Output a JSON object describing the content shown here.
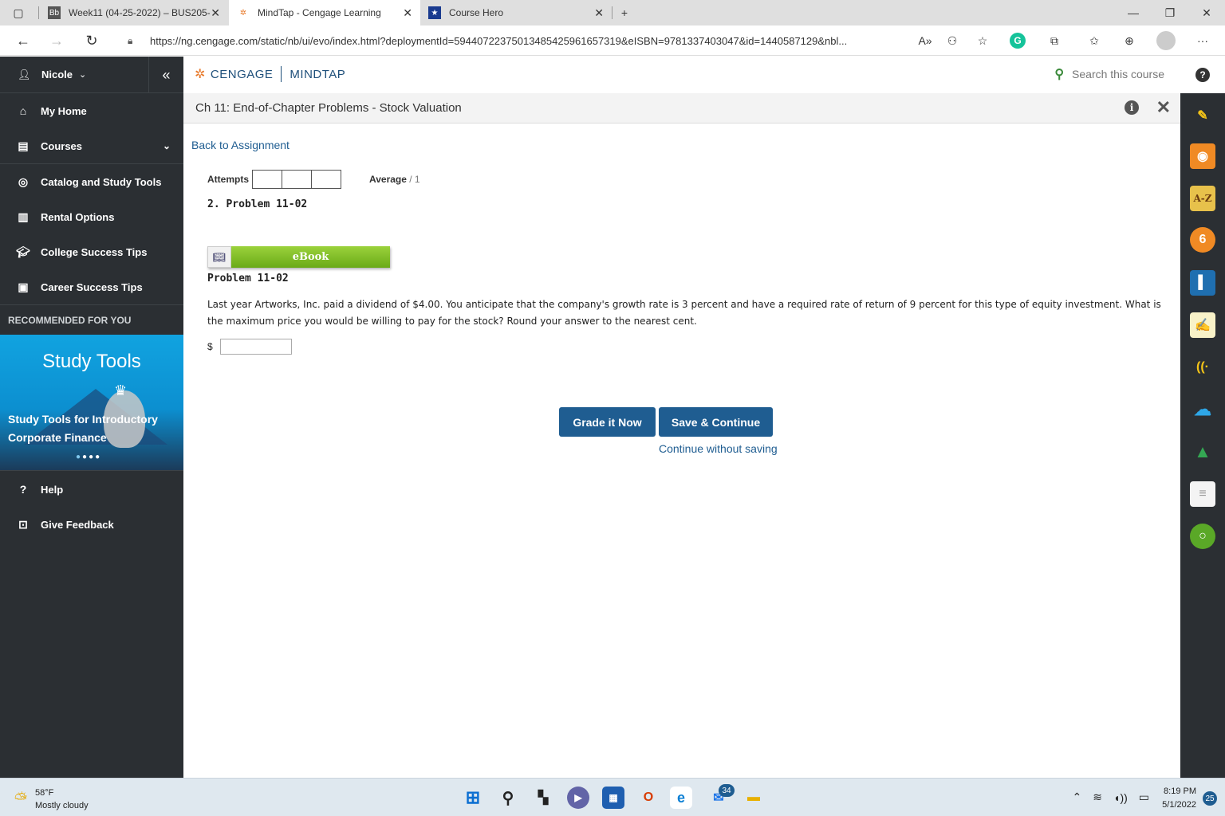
{
  "browser": {
    "tabs": [
      {
        "title": "Week11 (04-25-2022) – BUS205-",
        "favicon": "Bb"
      },
      {
        "title": "MindTap - Cengage Learning",
        "favicon": "cengage-icon"
      },
      {
        "title": "Course Hero",
        "favicon": "coursehero-icon"
      }
    ],
    "url": "https://ng.cengage.com/static/nb/ui/evo/index.html?deploymentId=59440722375013485425961657319&eISBN=9781337403047&id=1440587129&nbl..."
  },
  "sidebar": {
    "user": "Nicole",
    "items": [
      {
        "label": "My Home",
        "icon": "home-icon"
      },
      {
        "label": "Courses",
        "icon": "book-icon"
      },
      {
        "label": "Catalog and Study Tools",
        "icon": "compass-icon"
      },
      {
        "label": "Rental Options",
        "icon": "open-book-icon"
      },
      {
        "label": "College Success Tips",
        "icon": "graduation-cap-icon"
      },
      {
        "label": "Career Success Tips",
        "icon": "briefcase-icon"
      }
    ],
    "recommended_heading": "RECOMMENDED FOR YOU",
    "promo": {
      "title": "Study Tools",
      "text": "Study Tools for Introductory Corporate Finance"
    },
    "bottom": [
      {
        "label": "Help",
        "icon": "help-icon"
      },
      {
        "label": "Give Feedback",
        "icon": "feedback-icon"
      }
    ]
  },
  "header": {
    "brand_left": "CENGAGE",
    "brand_right": "MINDTAP",
    "search_placeholder": "Search this course"
  },
  "chapter": {
    "title": "Ch 11: End-of-Chapter Problems - Stock Valuation"
  },
  "content": {
    "back_link": "Back to Assignment",
    "attempts_label": "Attempts",
    "average_label": "Average",
    "average_value": "/ 1",
    "problem_heading": "2.  Problem 11-02",
    "ebook_label": "eBook",
    "problem_subheading": "Problem 11-02",
    "problem_text": "Last year Artworks, Inc. paid a dividend of $4.00. You anticipate that the company's growth rate is 3 percent and have a required rate of return of 9 percent for this type of equity investment. What is the maximum price you would be willing to pay for the stock? Round your answer to the nearest cent.",
    "currency": "$",
    "answer_value": "",
    "grade_button": "Grade it Now",
    "save_button": "Save & Continue",
    "continue_link": "Continue without saving"
  },
  "taskbar": {
    "temp": "58°F",
    "weather": "Mostly cloudy",
    "mail_badge": "34",
    "time": "8:19 PM",
    "date": "5/1/2022",
    "notifications": "25"
  }
}
